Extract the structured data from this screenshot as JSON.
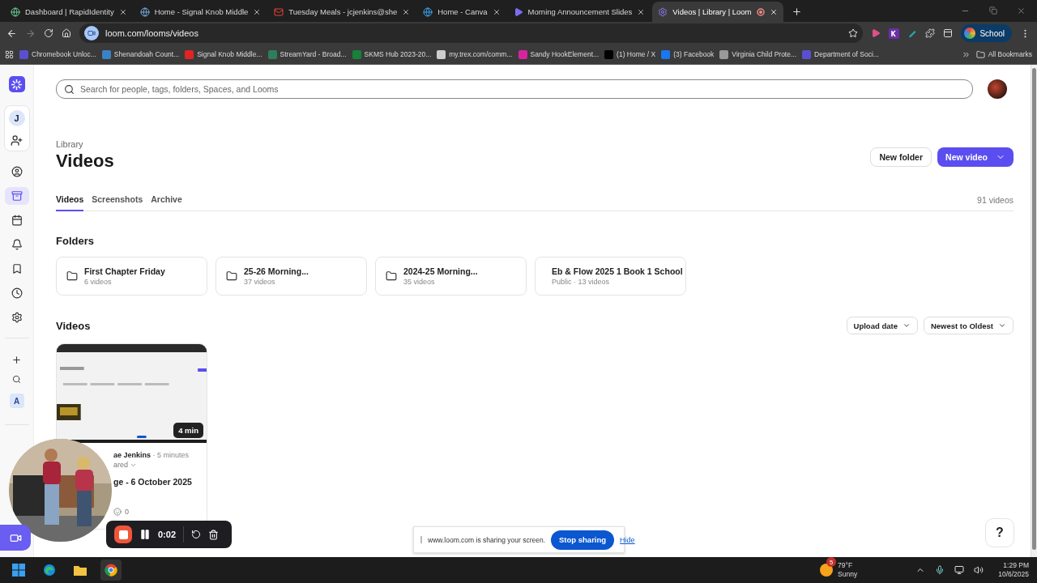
{
  "browser": {
    "tabs": [
      {
        "title": "Dashboard | RapidIdentity",
        "selected": false,
        "recording": false
      },
      {
        "title": "Home - Signal Knob Middle",
        "selected": false,
        "recording": false
      },
      {
        "title": "Tuesday Meals - jcjenkins@she",
        "selected": false,
        "recording": false
      },
      {
        "title": "Home - Canva",
        "selected": false,
        "recording": false
      },
      {
        "title": "Morning Announcement Slides",
        "selected": false,
        "recording": false
      },
      {
        "title": "Videos | Library | Loom",
        "selected": true,
        "recording": true
      }
    ],
    "url": "loom.com/looms/videos",
    "profile": "School",
    "bookmarks": [
      "Chromebook Unloc...",
      "Shenandoah Count...",
      "Signal Knob Middle...",
      "StreamYard - Broad...",
      "SKMS Hub 2023-20...",
      "my.trex.com/comm...",
      "Sandy HookElement...",
      "(1) Home / X",
      "(3) Facebook",
      "Virginia Child Prote...",
      "Department of Soci..."
    ],
    "all_bookmarks": "All Bookmarks"
  },
  "sidebar": {
    "workspace": "J",
    "nav": [
      {
        "selected": false
      },
      {
        "selected": true
      },
      {
        "selected": false
      },
      {
        "selected": false
      },
      {
        "selected": false
      },
      {
        "selected": false
      },
      {
        "selected": false
      }
    ],
    "space": "A"
  },
  "search": {
    "placeholder": "Search for people, tags, folders, Spaces, and Looms"
  },
  "header": {
    "breadcrumb": "Library",
    "title": "Videos",
    "new_folder": "New folder",
    "new_video": "New video"
  },
  "tabs": [
    {
      "label": "Videos",
      "selected": true
    },
    {
      "label": "Screenshots",
      "selected": false
    },
    {
      "label": "Archive",
      "selected": false
    }
  ],
  "count": "91 videos",
  "folders_title": "Folders",
  "folders": [
    {
      "name": "First Chapter Friday",
      "meta": "6 videos"
    },
    {
      "name": "25-26 Morning...",
      "meta": "37 videos"
    },
    {
      "name": "2024-25 Morning...",
      "meta": "35 videos"
    },
    {
      "name": "Eb & Flow 2025 1 Book 1 School",
      "meta": "Public · 13 videos"
    }
  ],
  "videos_title": "Videos",
  "sort": [
    "Upload date",
    "Newest to Oldest"
  ],
  "video": {
    "kind": "picture",
    "duration": "4 min",
    "author": "ae Jenkins",
    "time": "· 5 minutes",
    "visibility": "ared",
    "title": "ge - 6 October 2025",
    "reactions": "0"
  },
  "recorder": {
    "time": "0:02"
  },
  "share_banner": {
    "message": "www.loom.com is sharing your screen.",
    "stop": "Stop sharing",
    "hide": "Hide"
  },
  "help": "?",
  "taskbar": {
    "badge": "5",
    "temperature": "79°F",
    "condition": "Sunny",
    "time": "1:29 PM",
    "date": "10/6/2025"
  }
}
